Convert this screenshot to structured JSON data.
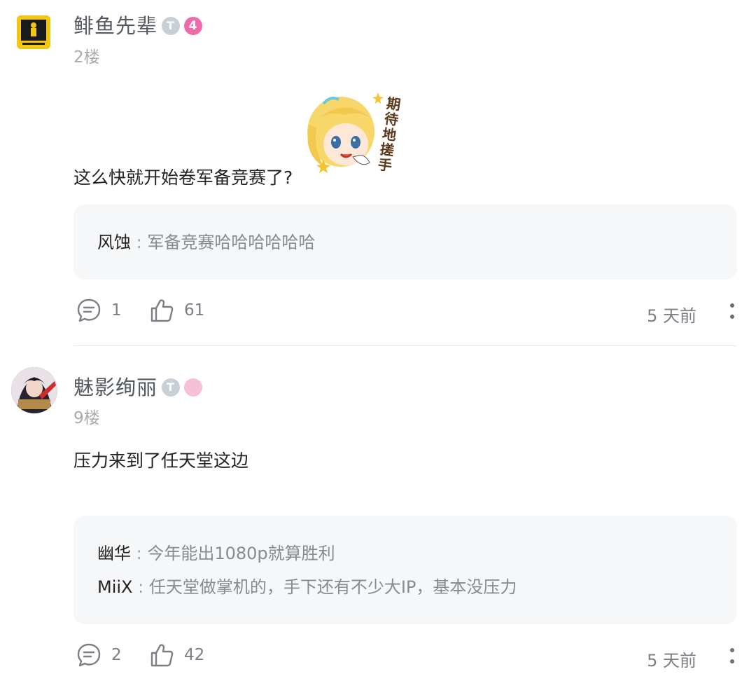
{
  "comments": [
    {
      "username": "鲱鱼先辈",
      "badge_t": "T",
      "badge_level": "4",
      "floor": "2楼",
      "text": "这么快就开始卷军备竞赛了?",
      "sticker_text": "期待地搓手",
      "replies": [
        {
          "name": "风蚀",
          "sep": " : ",
          "text": "军备竞赛哈哈哈哈哈哈"
        }
      ],
      "reply_count": "1",
      "like_count": "61",
      "time": "5 天前"
    },
    {
      "username": "魅影绚丽",
      "badge_t": "T",
      "floor": "9楼",
      "text": "压力来到了任天堂这边",
      "replies": [
        {
          "name": "幽华",
          "sep": " : ",
          "text": "今年能出1080p就算胜利"
        },
        {
          "name": "MiiX",
          "sep": " : ",
          "text": "任天堂做掌机的，手下还有不少大IP，基本没压力"
        }
      ],
      "reply_count": "2",
      "like_count": "42",
      "time": "5 天前"
    }
  ],
  "icons": {
    "comment": "speech-bubble-icon",
    "like": "thumbs-up-icon",
    "more": "vertical-ellipsis-icon"
  },
  "colors": {
    "level_badge": "#ef6aa8",
    "reply_bg": "#f6f7f9",
    "muted_text": "#7b7f85"
  }
}
